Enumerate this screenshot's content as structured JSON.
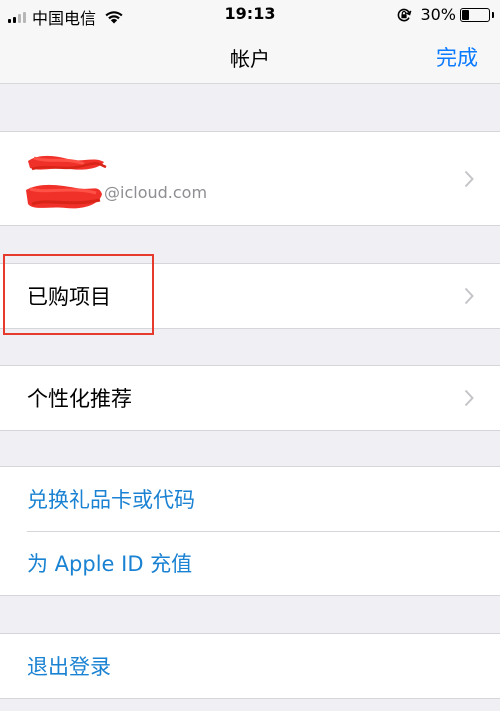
{
  "status_bar": {
    "carrier": "中国电信",
    "time": "19:13",
    "battery": "30%",
    "battery_level": 0.3,
    "signal_bars_active": 2,
    "signal_bars_total": 4
  },
  "nav": {
    "title": "帐户",
    "done": "完成"
  },
  "account": {
    "email_suffix": "@icloud.com"
  },
  "rows": {
    "purchased": "已购项目",
    "personalized": "个性化推荐",
    "redeem": "兑换礼品卡或代码",
    "add_funds": "为 Apple ID 充值",
    "sign_out": "退出登录"
  },
  "colors": {
    "link": "#1a82d2",
    "nav_accent": "#0a7aff",
    "highlight": "#e53a2c",
    "redaction": "#f0312a"
  }
}
